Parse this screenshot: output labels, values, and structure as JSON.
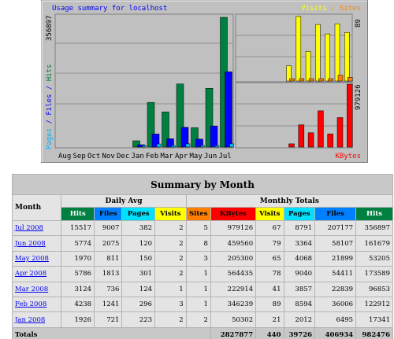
{
  "graph": {
    "title": "Usage summary for localhost",
    "left_axis_label": {
      "pages": "Pages",
      "files": "Files",
      "hits": "Hits",
      "sep": " / "
    },
    "left_axis_max": "356897",
    "top_right_legend": {
      "visits": "Visits",
      "sites": "Sites",
      "sep": " / "
    },
    "top_right_max": "89",
    "bottom_right_legend": "KBytes",
    "bottom_right_max": "979126",
    "colors": {
      "hits": "#008040",
      "files": "#0000ff",
      "pages": "#00c0ff",
      "visits": "#ffff00",
      "sites": "#ff8000",
      "kbytes": "#ff0000",
      "panel": "#c0c0c0",
      "title": "#0000ff"
    }
  },
  "chart_data": [
    {
      "type": "bar",
      "title": "Usage summary for localhost",
      "categories": [
        "Aug",
        "Sep",
        "Oct",
        "Nov",
        "Dec",
        "Jan",
        "Feb",
        "Mar",
        "Apr",
        "May",
        "Jun",
        "Jul"
      ],
      "series": [
        {
          "name": "Hits",
          "values": [
            0,
            0,
            0,
            0,
            0,
            17341,
            122912,
            96853,
            173589,
            53205,
            161679,
            356897
          ]
        },
        {
          "name": "Files",
          "values": [
            0,
            0,
            0,
            0,
            0,
            6495,
            36006,
            22839,
            54411,
            21899,
            58107,
            207177
          ]
        },
        {
          "name": "Pages",
          "values": [
            0,
            0,
            0,
            0,
            0,
            2012,
            8594,
            3857,
            9040,
            4068,
            3364,
            8791
          ]
        }
      ],
      "ylim": [
        0,
        356897
      ]
    },
    {
      "type": "bar",
      "categories": [
        "Aug",
        "Sep",
        "Oct",
        "Nov",
        "Dec",
        "Jan",
        "Feb",
        "Mar",
        "Apr",
        "May",
        "Jun",
        "Jul"
      ],
      "series": [
        {
          "name": "Visits",
          "values": [
            0,
            0,
            0,
            0,
            0,
            21,
            89,
            41,
            78,
            65,
            79,
            67
          ]
        },
        {
          "name": "Sites",
          "values": [
            0,
            0,
            0,
            0,
            0,
            2,
            1,
            1,
            1,
            3,
            8,
            5
          ]
        }
      ],
      "ylim": [
        0,
        89
      ]
    },
    {
      "type": "bar",
      "categories": [
        "Aug",
        "Sep",
        "Oct",
        "Nov",
        "Dec",
        "Jan",
        "Feb",
        "Mar",
        "Apr",
        "May",
        "Jun",
        "Jul"
      ],
      "series": [
        {
          "name": "KBytes",
          "values": [
            0,
            0,
            0,
            0,
            0,
            50302,
            346239,
            222914,
            564435,
            205300,
            459560,
            979126
          ]
        }
      ],
      "ylim": [
        0,
        979126
      ]
    }
  ],
  "table": {
    "title": "Summary by Month",
    "month_header": "Month",
    "daily_avg_header": "Daily Avg",
    "monthly_totals_header": "Monthly Totals",
    "columns": {
      "hits": "Hits",
      "files": "Files",
      "pages": "Pages",
      "visits": "Visits",
      "sites": "Sites",
      "kbytes": "KBytes"
    },
    "rows": [
      {
        "month": "Jul 2008",
        "avg_hits": "15517",
        "avg_files": "9007",
        "avg_pages": "382",
        "avg_visits": "2",
        "sites": "5",
        "kbytes": "979126",
        "visits": "67",
        "pages": "8791",
        "files": "207177",
        "hits": "356897"
      },
      {
        "month": "Jun 2008",
        "avg_hits": "5774",
        "avg_files": "2075",
        "avg_pages": "120",
        "avg_visits": "2",
        "sites": "8",
        "kbytes": "459560",
        "visits": "79",
        "pages": "3364",
        "files": "58107",
        "hits": "161679"
      },
      {
        "month": "May 2008",
        "avg_hits": "1970",
        "avg_files": "811",
        "avg_pages": "150",
        "avg_visits": "2",
        "sites": "3",
        "kbytes": "205300",
        "visits": "65",
        "pages": "4068",
        "files": "21899",
        "hits": "53205"
      },
      {
        "month": "Apr 2008",
        "avg_hits": "5786",
        "avg_files": "1813",
        "avg_pages": "301",
        "avg_visits": "2",
        "sites": "1",
        "kbytes": "564435",
        "visits": "78",
        "pages": "9040",
        "files": "54411",
        "hits": "173589"
      },
      {
        "month": "Mar 2008",
        "avg_hits": "3124",
        "avg_files": "736",
        "avg_pages": "124",
        "avg_visits": "1",
        "sites": "1",
        "kbytes": "222914",
        "visits": "41",
        "pages": "3857",
        "files": "22839",
        "hits": "96853"
      },
      {
        "month": "Feb 2008",
        "avg_hits": "4238",
        "avg_files": "1241",
        "avg_pages": "296",
        "avg_visits": "3",
        "sites": "1",
        "kbytes": "346239",
        "visits": "89",
        "pages": "8594",
        "files": "36006",
        "hits": "122912"
      },
      {
        "month": "Jan 2008",
        "avg_hits": "1926",
        "avg_files": "721",
        "avg_pages": "223",
        "avg_visits": "2",
        "sites": "2",
        "kbytes": "50302",
        "visits": "21",
        "pages": "2012",
        "files": "6495",
        "hits": "17341"
      }
    ],
    "totals": {
      "label": "Totals",
      "kbytes": "2827877",
      "visits": "440",
      "pages": "39726",
      "files": "406934",
      "hits": "982476"
    }
  }
}
